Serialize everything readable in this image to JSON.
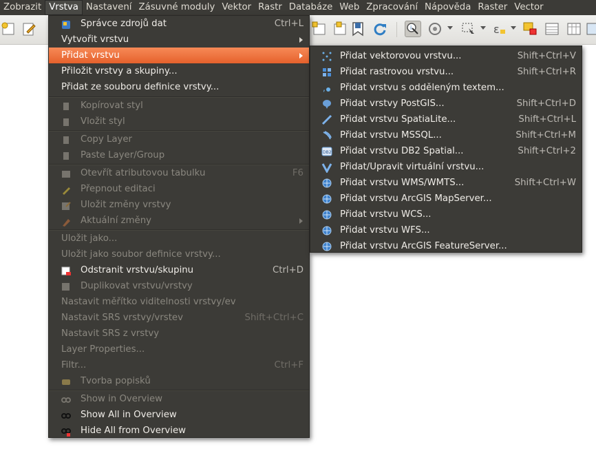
{
  "menubar": [
    "Zobrazit",
    "Vrstva",
    "Nastavení",
    "Zásuvné moduly",
    "Vektor",
    "Rastr",
    "Databáze",
    "Web",
    "Zpracování",
    "Nápověda",
    "Raster",
    "Vector"
  ],
  "menubar_active": "Vrstva",
  "main_menu": {
    "source_manager": {
      "label": "Správce zdrojů dat",
      "shortcut": "Ctrl+L"
    },
    "create_layer": {
      "label": "Vytvořit vrstvu"
    },
    "add_layer": {
      "label": "Přidat vrstvu"
    },
    "embed": {
      "label": "Přiložit vrstvy a skupiny..."
    },
    "add_from_def": {
      "label": "Přidat ze souboru definice vrstvy..."
    },
    "copy_style": {
      "label": "Kopírovat styl"
    },
    "paste_style": {
      "label": "Vložit styl"
    },
    "copy_layer": {
      "label": "Copy Layer"
    },
    "paste_layer": {
      "label": "Paste Layer/Group"
    },
    "open_attr": {
      "label": "Otevřít atributovou tabulku",
      "shortcut": "F6"
    },
    "toggle_edit": {
      "label": "Přepnout editaci"
    },
    "save_edits": {
      "label": "Uložit změny vrstvy"
    },
    "current_edits": {
      "label": "Aktuální změny"
    },
    "save_as": {
      "label": "Uložit jako..."
    },
    "save_def": {
      "label": "Uložit jako soubor definice vrstvy..."
    },
    "remove": {
      "label": "Odstranit vrstvu/skupinu",
      "shortcut": "Ctrl+D"
    },
    "duplicate": {
      "label": "Duplikovat vrstvu/vrstvy"
    },
    "scale_vis": {
      "label": "Nastavit měřítko viditelnosti vrstvy/ev"
    },
    "set_crs": {
      "label": "Nastavit SRS vrstvy/vrstev",
      "shortcut": "Shift+Ctrl+C"
    },
    "crs_from_layer": {
      "label": "Nastavit SRS z vrstvy"
    },
    "layer_props": {
      "label": "Layer Properties..."
    },
    "filter": {
      "label": "Filtr...",
      "shortcut": "Ctrl+F"
    },
    "labeling": {
      "label": "Tvorba popisků"
    },
    "show_overview": {
      "label": "Show in Overview"
    },
    "show_all_overview": {
      "label": "Show All in Overview"
    },
    "hide_all_overview": {
      "label": "Hide All from Overview"
    }
  },
  "sub_menu": [
    {
      "label": "Přidat vektorovou vrstvu...",
      "shortcut": "Shift+Ctrl+V",
      "icon": "vector-layer-icon"
    },
    {
      "label": "Přidat rastrovou vrstvu...",
      "shortcut": "Shift+Ctrl+R",
      "icon": "raster-layer-icon"
    },
    {
      "label": "Přidat vrstvu s odděleným textem...",
      "shortcut": "",
      "icon": "delimited-text-icon"
    },
    {
      "label": "Přidat vrstvy PostGIS...",
      "shortcut": "Shift+Ctrl+D",
      "icon": "postgis-icon"
    },
    {
      "label": "Přidat vrstvu SpatiaLite...",
      "shortcut": "Shift+Ctrl+L",
      "icon": "spatialite-icon"
    },
    {
      "label": "Přidat vrstvu MSSQL...",
      "shortcut": "Shift+Ctrl+M",
      "icon": "mssql-icon"
    },
    {
      "label": "Přidat vrstvu DB2 Spatial...",
      "shortcut": "Shift+Ctrl+2",
      "icon": "db2-icon"
    },
    {
      "label": "Přidat/Upravit virtuální vrstvu...",
      "shortcut": "",
      "icon": "virtual-layer-icon"
    },
    {
      "label": "Přidat vrstvu WMS/WMTS...",
      "shortcut": "Shift+Ctrl+W",
      "icon": "wms-icon"
    },
    {
      "label": "Přidat vrstvu ArcGIS MapServer...",
      "shortcut": "",
      "icon": "arcgis-mapserver-icon"
    },
    {
      "label": "Přidat vrstvu WCS...",
      "shortcut": "",
      "icon": "wcs-icon"
    },
    {
      "label": "Přidat vrstvu WFS...",
      "shortcut": "",
      "icon": "wfs-icon"
    },
    {
      "label": "Přidat vrstvu ArcGIS FeatureServer...",
      "shortcut": "",
      "icon": "arcgis-featureserver-icon"
    }
  ],
  "colors": {
    "menu_bg": "#3c3b37",
    "highlight": "#f07746",
    "text": "#efece7",
    "disabled": "#8a877f"
  }
}
